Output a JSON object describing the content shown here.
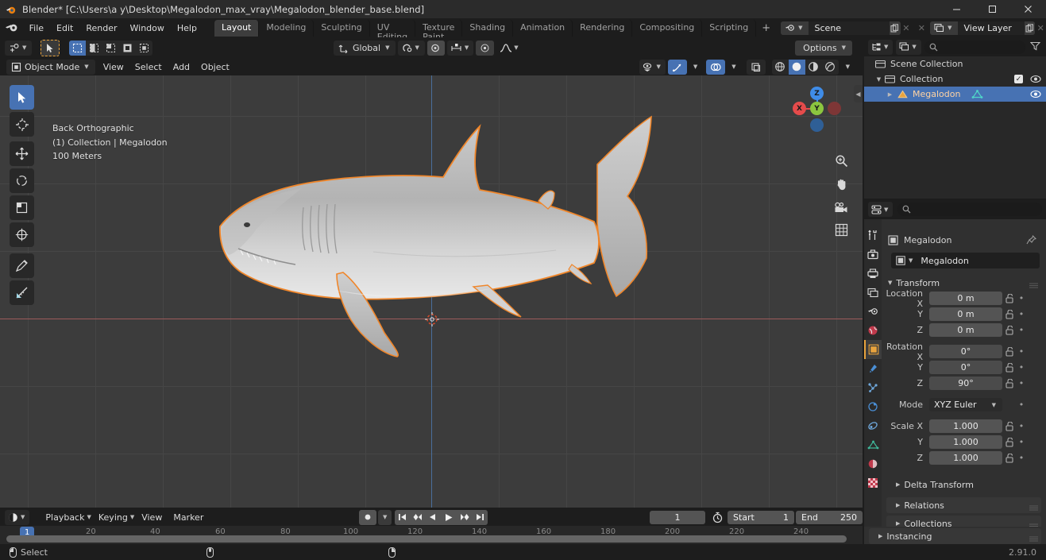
{
  "window": {
    "title": "Blender* [C:\\Users\\a y\\Desktop\\Megalodon_max_vray\\Megalodon_blender_base.blend]",
    "minimize": "—",
    "maximize": "▢",
    "close": "✕"
  },
  "topbar": {
    "menus": [
      "File",
      "Edit",
      "Render",
      "Window",
      "Help"
    ],
    "workspaces": [
      {
        "label": "Layout",
        "active": true
      },
      {
        "label": "Modeling",
        "active": false
      },
      {
        "label": "Sculpting",
        "active": false
      },
      {
        "label": "UV Editing",
        "active": false
      },
      {
        "label": "Texture Paint",
        "active": false
      },
      {
        "label": "Shading",
        "active": false
      },
      {
        "label": "Animation",
        "active": false
      },
      {
        "label": "Rendering",
        "active": false
      },
      {
        "label": "Compositing",
        "active": false
      },
      {
        "label": "Scripting",
        "active": false
      }
    ],
    "add_workspace": "+",
    "scene_name": "Scene",
    "view_layer_name": "View Layer"
  },
  "viewport": {
    "mode": "Object Mode",
    "menus": [
      "View",
      "Select",
      "Add",
      "Object"
    ],
    "transform_orientation": "Global",
    "options_label": "Options",
    "overlay_text": {
      "line1": "Back Orthographic",
      "line2": "(1) Collection | Megalodon",
      "line3": "100 Meters"
    },
    "gizmo_axes": {
      "x": "X",
      "y": "Y",
      "z": "Z"
    }
  },
  "outliner": {
    "search_placeholder": "",
    "rows": [
      {
        "label": "Scene Collection",
        "indent": 0,
        "icon": "collection-icon",
        "selected": false,
        "has_disclosure": false,
        "has_checkbox": false,
        "has_eye": false
      },
      {
        "label": "Collection",
        "indent": 1,
        "icon": "collection-icon",
        "selected": false,
        "has_disclosure": true,
        "has_checkbox": true,
        "has_eye": true
      },
      {
        "label": "Megalodon",
        "indent": 2,
        "icon": "mesh-object-icon",
        "selected": true,
        "has_disclosure": true,
        "has_checkbox": false,
        "has_eye": true
      }
    ]
  },
  "properties": {
    "search_placeholder": "",
    "breadcrumb_object": "Megalodon",
    "object_name_field": "Megalodon",
    "transform": {
      "title": "Transform",
      "location": {
        "label": "Location X",
        "y_label": "Y",
        "z_label": "Z",
        "x": "0 m",
        "y": "0 m",
        "z": "0 m"
      },
      "rotation": {
        "label": "Rotation X",
        "y_label": "Y",
        "z_label": "Z",
        "x": "0°",
        "y": "0°",
        "z": "90°"
      },
      "mode": {
        "label": "Mode",
        "value": "XYZ Euler"
      },
      "scale": {
        "label": "Scale X",
        "y_label": "Y",
        "z_label": "Z",
        "x": "1.000",
        "y": "1.000",
        "z": "1.000"
      }
    },
    "panels": [
      "Delta Transform",
      "Relations",
      "Collections",
      "Instancing"
    ],
    "tabs": [
      "tool-icon",
      "render-icon",
      "output-icon",
      "view-layer-icon",
      "scene-icon",
      "world-icon",
      "object-icon",
      "modifiers-icon",
      "particles-icon",
      "physics-icon",
      "constraints-icon",
      "object-data-icon",
      "material-icon",
      "texture-icon"
    ]
  },
  "timeline": {
    "editor_type": "timeline-icon",
    "menus": [
      "Playback",
      "Keying",
      "View",
      "Marker"
    ],
    "current_frame": "1",
    "start_label": "Start",
    "start_value": "1",
    "end_label": "End",
    "end_value": "250",
    "ticks": [
      "20",
      "40",
      "60",
      "80",
      "100",
      "120",
      "140",
      "160",
      "180",
      "200",
      "220",
      "240"
    ],
    "playhead_frame": "1"
  },
  "statusbar": {
    "select_label": "Select",
    "version": "2.91.0"
  },
  "colors": {
    "accent_blue": "#4772b3",
    "accent_orange": "#e8a33d",
    "axis_x": "#e54b4b",
    "axis_y": "#8cc63f",
    "axis_z": "#3f8ce8",
    "panel_bg": "#303030",
    "header_bg": "#1d1d1d"
  }
}
